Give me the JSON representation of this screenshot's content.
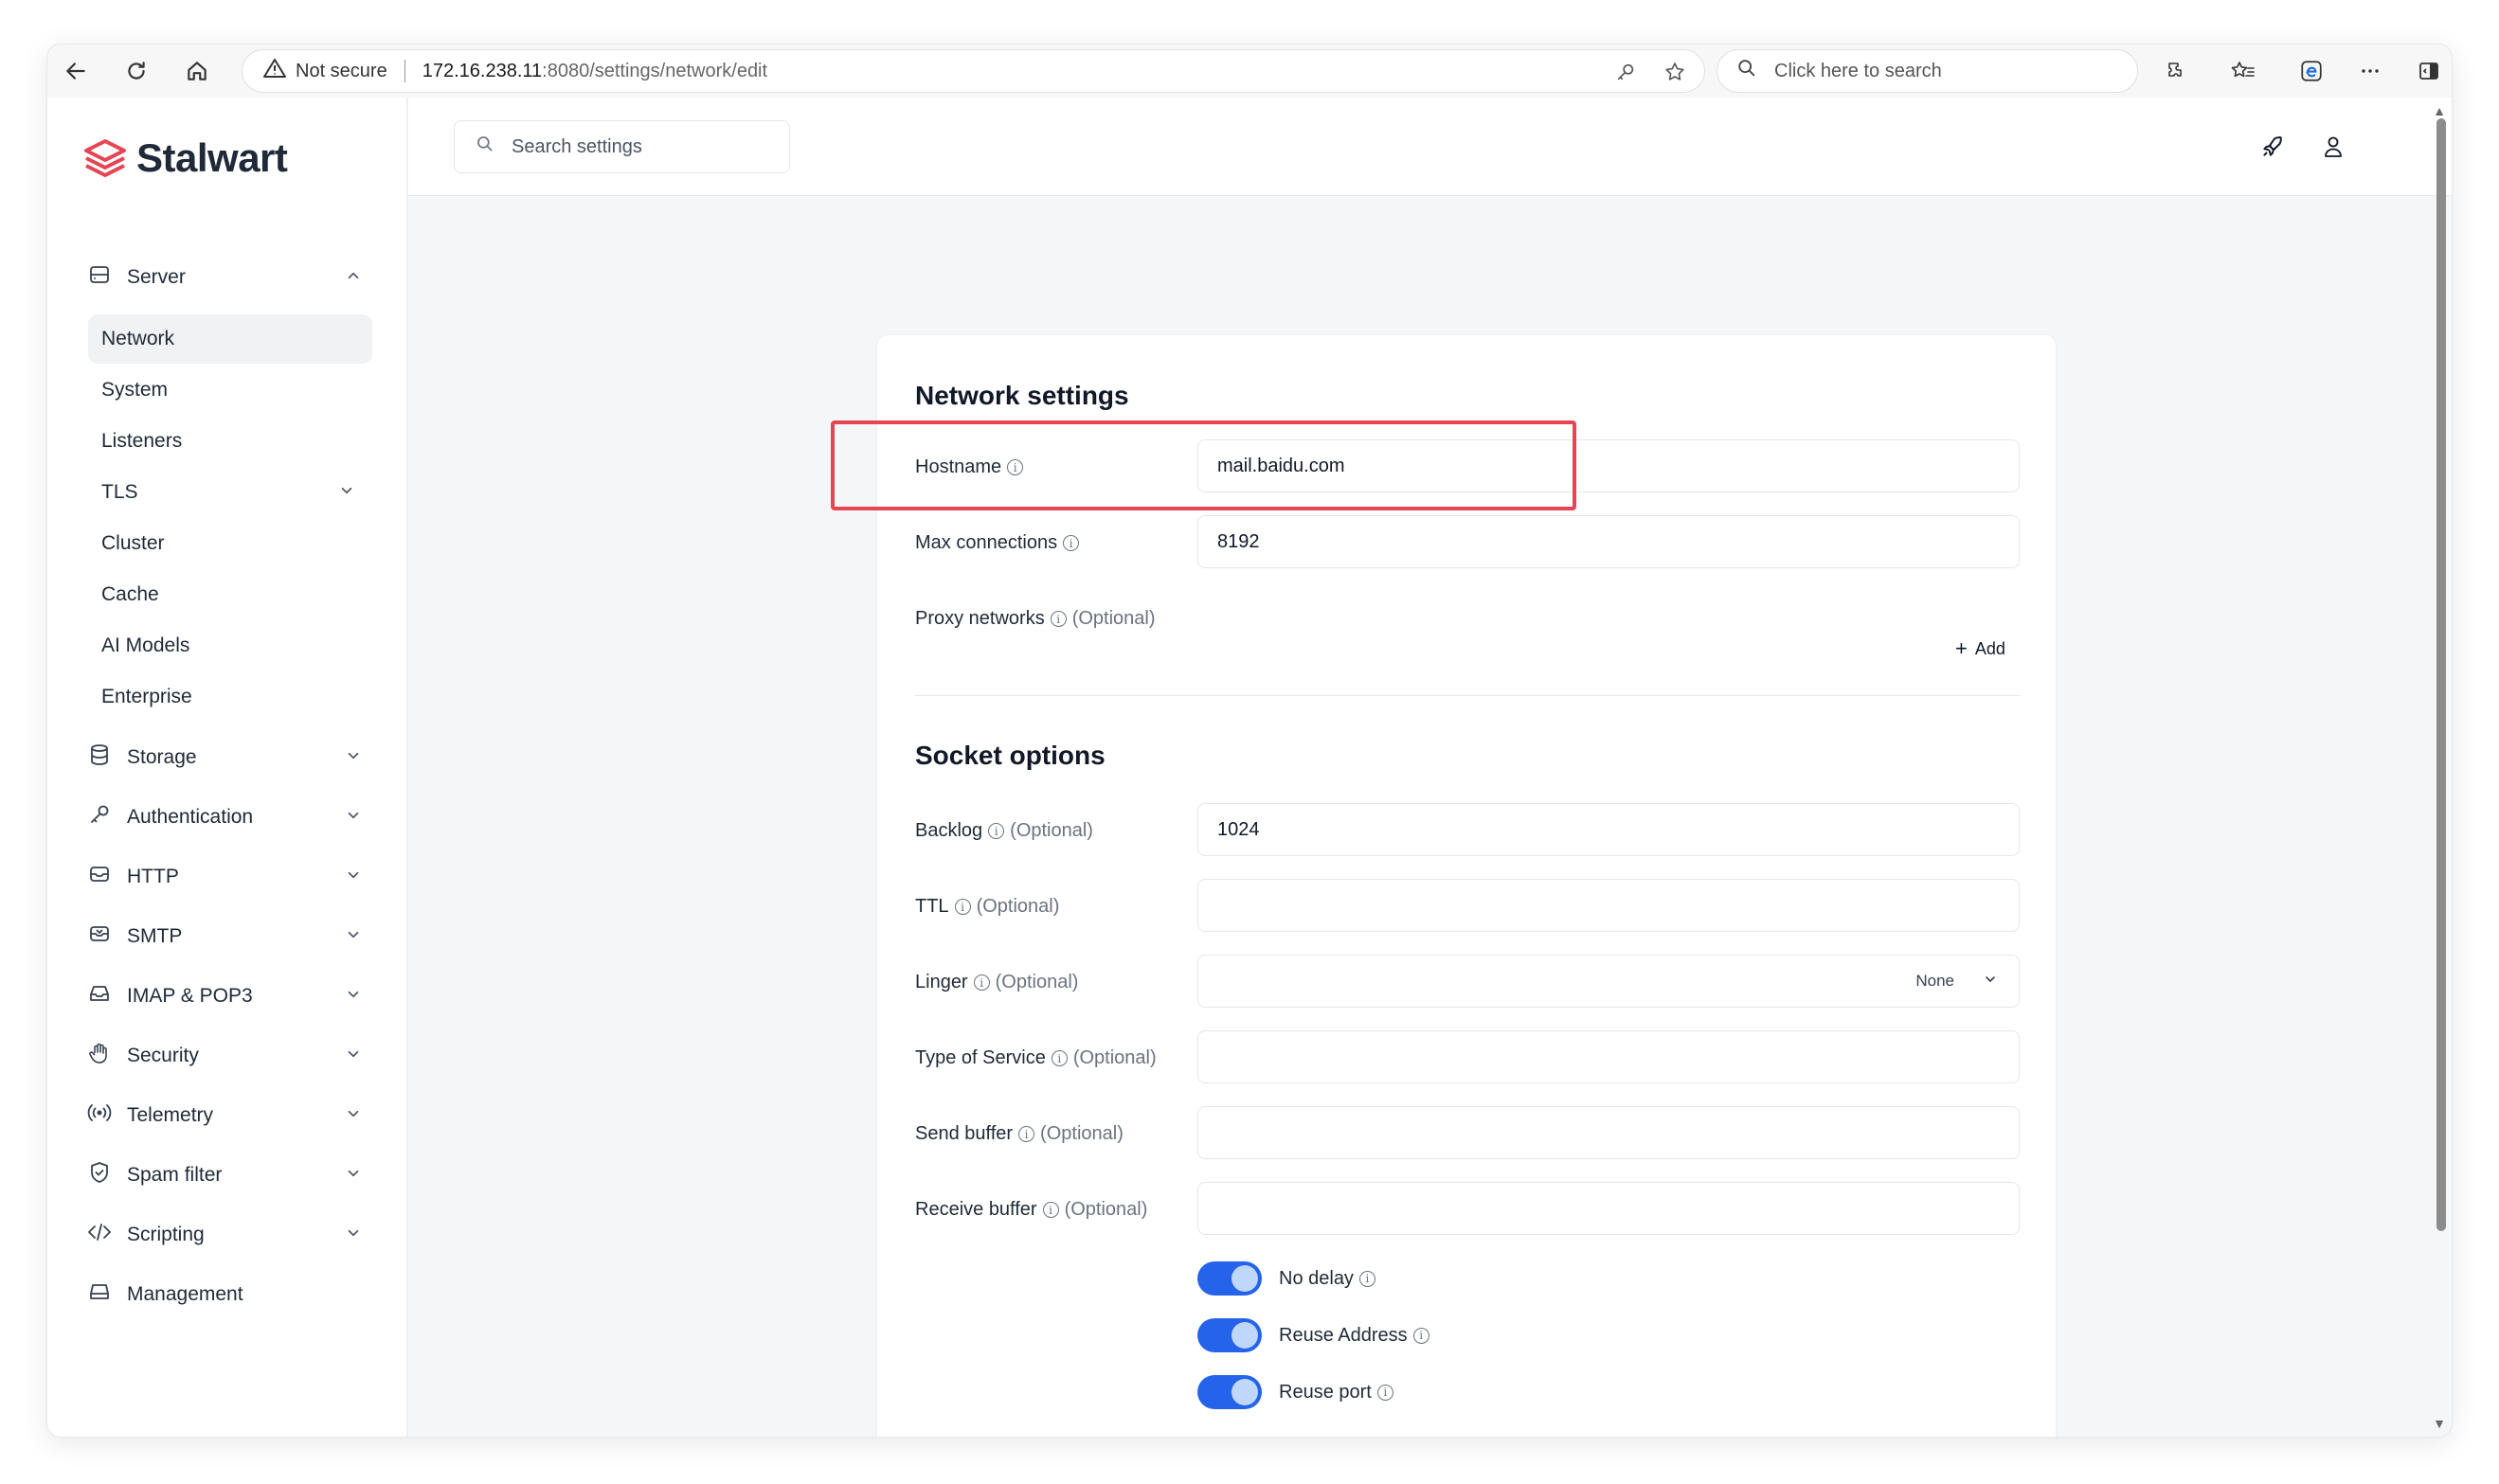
{
  "browser": {
    "security_label": "Not secure",
    "url_host": "172.16.238.11",
    "url_path": ":8080/settings/network/edit",
    "search_placeholder": "Click here to search"
  },
  "app": {
    "logo_text": "Stalwart",
    "search_placeholder": "Search settings",
    "brand_color": "#e64553",
    "accent_color": "#2563eb"
  },
  "sidebar": {
    "server": {
      "label": "Server",
      "icon": "server-icon"
    },
    "server_items": [
      {
        "label": "Network",
        "active": true
      },
      {
        "label": "System"
      },
      {
        "label": "Listeners"
      },
      {
        "label": "TLS",
        "expandable": true
      },
      {
        "label": "Cluster"
      },
      {
        "label": "Cache"
      },
      {
        "label": "AI Models"
      },
      {
        "label": "Enterprise"
      }
    ],
    "groups": [
      {
        "label": "Storage",
        "icon": "database-icon"
      },
      {
        "label": "Authentication",
        "icon": "key-icon"
      },
      {
        "label": "HTTP",
        "icon": "http-icon"
      },
      {
        "label": "SMTP",
        "icon": "smtp-icon"
      },
      {
        "label": "IMAP & POP3",
        "icon": "inbox-icon"
      },
      {
        "label": "Security",
        "icon": "hand-icon"
      },
      {
        "label": "Telemetry",
        "icon": "broadcast-icon"
      },
      {
        "label": "Spam filter",
        "icon": "shield-icon"
      },
      {
        "label": "Scripting",
        "icon": "code-icon"
      },
      {
        "label": "Management",
        "icon": "management-icon"
      }
    ]
  },
  "network_settings": {
    "title": "Network settings",
    "hostname": {
      "label": "Hostname",
      "value": "mail.baidu.com"
    },
    "max_connections": {
      "label": "Max connections",
      "value": "8192"
    },
    "proxy_networks": {
      "label": "Proxy networks",
      "optional": "(Optional)",
      "add_label": "Add"
    }
  },
  "socket_options": {
    "title": "Socket options",
    "backlog": {
      "label": "Backlog",
      "optional": "(Optional)",
      "value": "1024"
    },
    "ttl": {
      "label": "TTL",
      "optional": "(Optional)",
      "value": ""
    },
    "linger": {
      "label": "Linger",
      "optional": "(Optional)",
      "value": "None"
    },
    "tos": {
      "label": "Type of Service",
      "optional": "(Optional)",
      "value": ""
    },
    "send_buffer": {
      "label": "Send buffer",
      "optional": "(Optional)",
      "value": ""
    },
    "receive_buffer": {
      "label": "Receive buffer",
      "optional": "(Optional)",
      "value": ""
    },
    "no_delay": {
      "label": "No delay",
      "on": true
    },
    "reuse_address": {
      "label": "Reuse Address",
      "on": true
    },
    "reuse_port": {
      "label": "Reuse port",
      "on": true
    }
  }
}
